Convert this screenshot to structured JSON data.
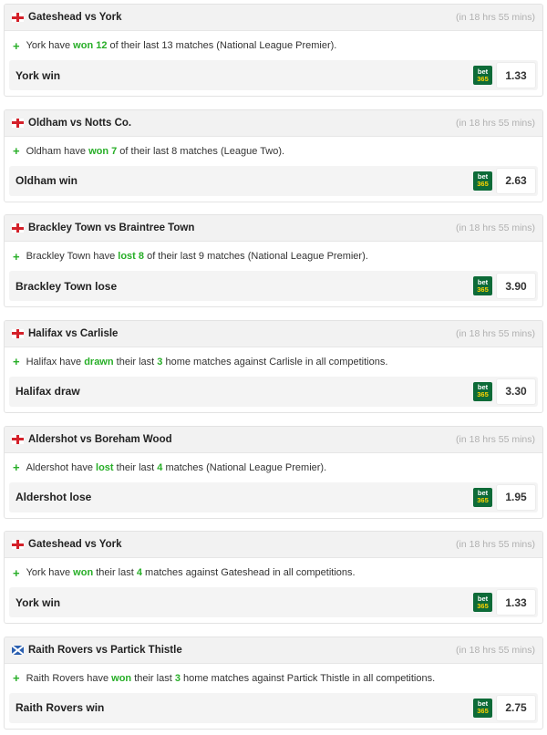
{
  "tips": [
    {
      "flag": "england-flag-icon",
      "title": "Gateshead vs York",
      "eta": "(in 18 hrs 55 mins)",
      "stat": [
        "York have ",
        "won 12",
        " of their last 13 matches (National League Premier)."
      ],
      "pick": "York win",
      "bookmaker": [
        "bet",
        "365"
      ],
      "odds": "1.33"
    },
    {
      "flag": "england-flag-icon",
      "title": "Oldham vs Notts Co.",
      "eta": "(in 18 hrs 55 mins)",
      "stat": [
        "Oldham have ",
        "won 7",
        " of their last 8 matches (League Two)."
      ],
      "pick": "Oldham win",
      "bookmaker": [
        "bet",
        "365"
      ],
      "odds": "2.63"
    },
    {
      "flag": "england-flag-icon",
      "title": "Brackley Town vs Braintree Town",
      "eta": "(in 18 hrs 55 mins)",
      "stat": [
        "Brackley Town have ",
        "lost 8",
        " of their last 9 matches (National League Premier)."
      ],
      "pick": "Brackley Town lose",
      "bookmaker": [
        "bet",
        "365"
      ],
      "odds": "3.90"
    },
    {
      "flag": "england-flag-icon",
      "title": "Halifax vs Carlisle",
      "eta": "(in 18 hrs 55 mins)",
      "stat": [
        "Halifax have ",
        "drawn",
        " their last ",
        "3",
        " home matches against Carlisle in all competitions."
      ],
      "pick": "Halifax draw",
      "bookmaker": [
        "bet",
        "365"
      ],
      "odds": "3.30"
    },
    {
      "flag": "england-flag-icon",
      "title": "Aldershot vs Boreham Wood",
      "eta": "(in 18 hrs 55 mins)",
      "stat": [
        "Aldershot have ",
        "lost",
        " their last ",
        "4",
        " matches (National League Premier)."
      ],
      "pick": "Aldershot lose",
      "bookmaker": [
        "bet",
        "365"
      ],
      "odds": "1.95"
    },
    {
      "flag": "england-flag-icon",
      "title": "Gateshead vs York",
      "eta": "(in 18 hrs 55 mins)",
      "stat": [
        "York have ",
        "won",
        " their last ",
        "4",
        " matches against Gateshead in all competitions."
      ],
      "pick": "York win",
      "bookmaker": [
        "bet",
        "365"
      ],
      "odds": "1.33"
    },
    {
      "flag": "scotland-flag-icon",
      "title": "Raith Rovers vs Partick Thistle",
      "eta": "(in 18 hrs 55 mins)",
      "stat": [
        "Raith Rovers have ",
        "won",
        " their last ",
        "3",
        " home matches against Partick Thistle in all competitions."
      ],
      "pick": "Raith Rovers win",
      "bookmaker": [
        "bet",
        "365"
      ],
      "odds": "2.75"
    }
  ]
}
